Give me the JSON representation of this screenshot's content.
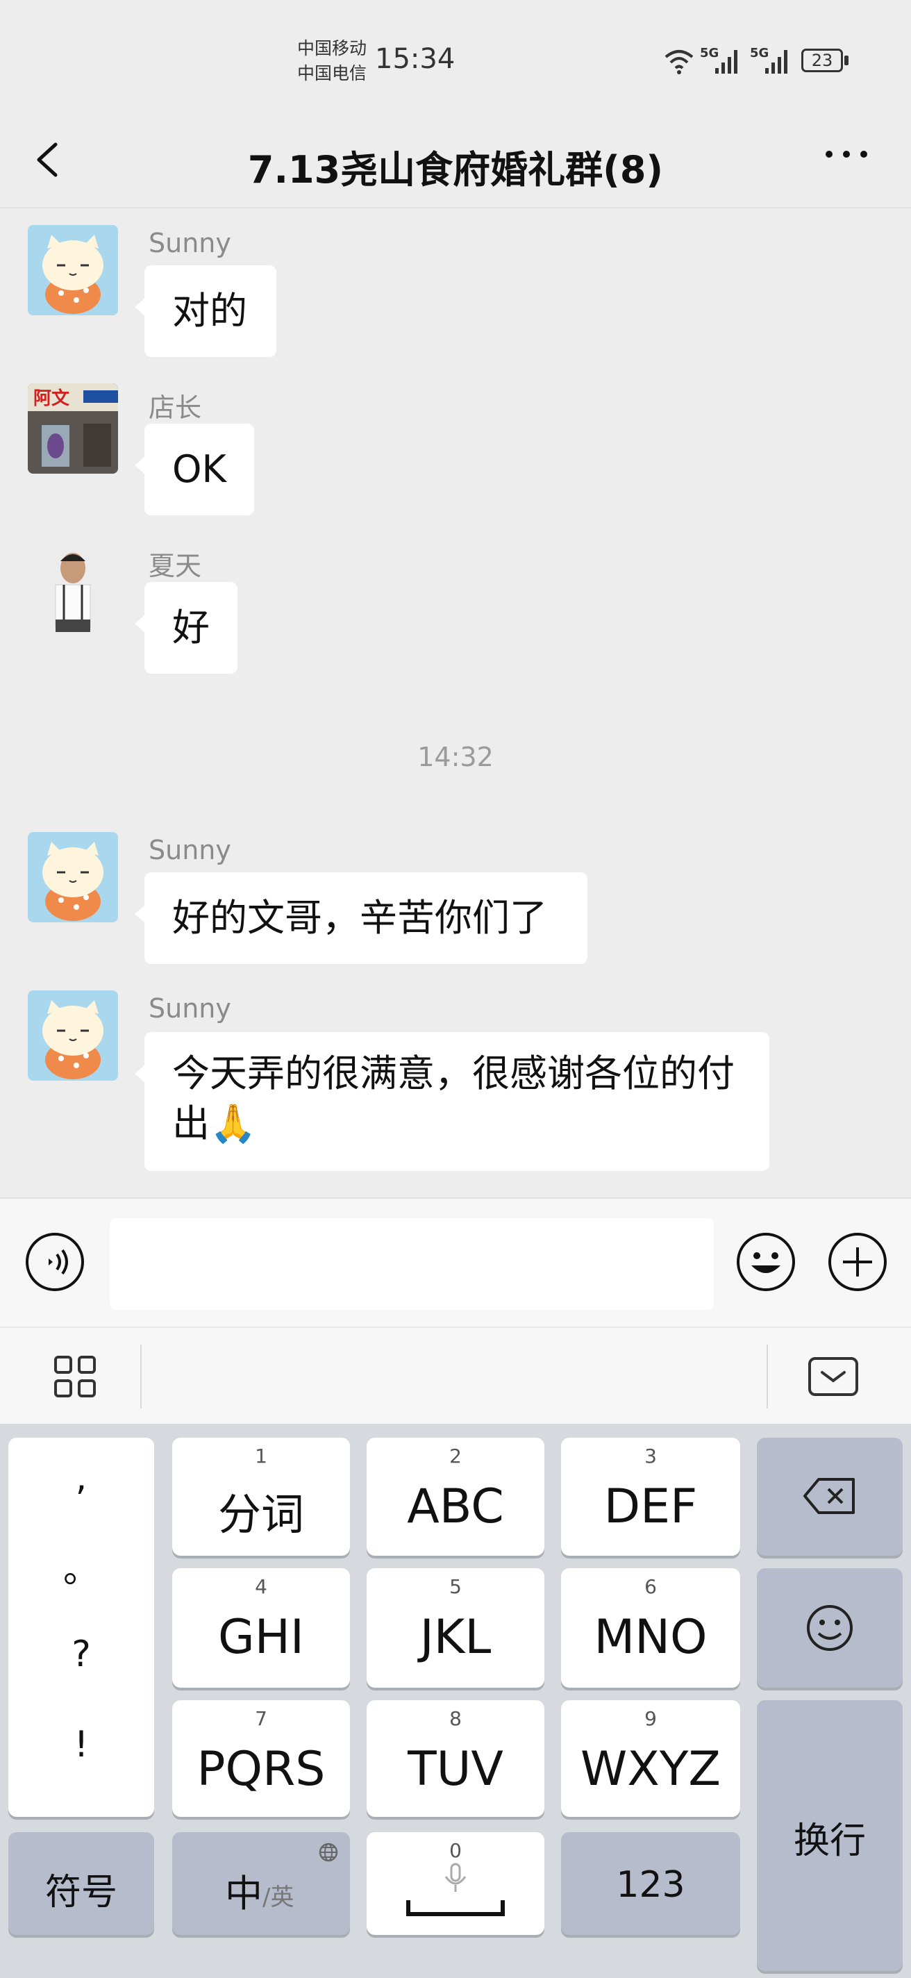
{
  "status_bar": {
    "carrier_1": "中国移动",
    "carrier_2": "中国电信",
    "time": "15:34",
    "network_1": "5G",
    "network_2": "5G",
    "battery": "23"
  },
  "header": {
    "title": "7.13尧山食府婚礼群(8)"
  },
  "messages": [
    {
      "sender": "Sunny",
      "text": "对的"
    },
    {
      "sender": "店长",
      "text": "OK"
    },
    {
      "sender": "夏天",
      "text": "好"
    },
    {
      "sender": "Sunny",
      "text": "好的文哥，辛苦你们了"
    },
    {
      "sender": "Sunny",
      "text_line1": "今天弄的很满意，很感谢各位的付",
      "text_line2": "出",
      "emoji": "🙏"
    }
  ],
  "timestamp": "14:32",
  "input": {
    "value": ""
  },
  "keyboard": {
    "punct": [
      ",",
      "。",
      "?",
      "!"
    ],
    "keys": [
      {
        "num": "1",
        "label": "分词"
      },
      {
        "num": "2",
        "label": "ABC"
      },
      {
        "num": "3",
        "label": "DEF"
      },
      {
        "num": "4",
        "label": "GHI"
      },
      {
        "num": "5",
        "label": "JKL"
      },
      {
        "num": "6",
        "label": "MNO"
      },
      {
        "num": "7",
        "label": "PQRS"
      },
      {
        "num": "8",
        "label": "TUV"
      },
      {
        "num": "9",
        "label": "WXYZ"
      }
    ],
    "symbols": "符号",
    "lang_main": "中",
    "lang_alt": "/英",
    "space_num": "0",
    "numbers": "123",
    "enter": "换行"
  },
  "colors": {
    "background": "#ededed",
    "bubble": "#ffffff",
    "keyboard": "#d6d9de",
    "key_gray": "#b6bccb"
  }
}
